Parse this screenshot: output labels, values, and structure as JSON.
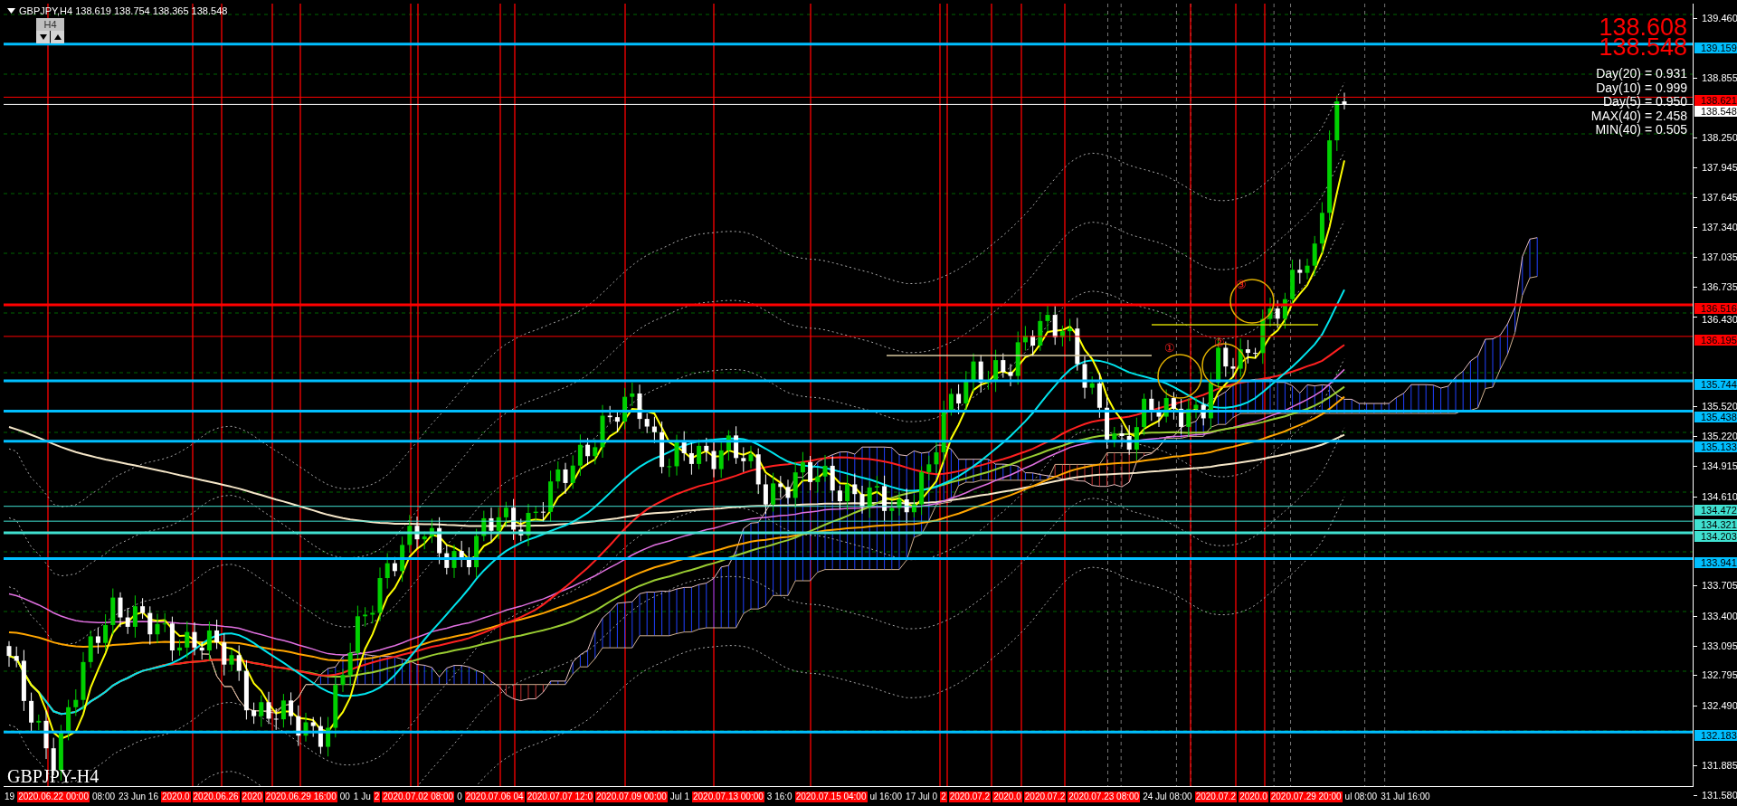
{
  "chart": {
    "title": "GBPJPY,H4 138.619 138.754 138.365 138.548",
    "period_button": {
      "label": "H4"
    },
    "price_big": [
      "138.608",
      "138.548"
    ],
    "stats": [
      "Day(20) = 0.931",
      "Day(10) = 0.999",
      "Day(5) = 0.950",
      "MAX(40) = 2.458",
      "MIN(40) = 0.505"
    ],
    "annotations": [
      "①",
      "②",
      "③"
    ],
    "chart_label": "GBPJPY-H4"
  },
  "price_axis": [
    {
      "text": "139.460",
      "kind": "tick"
    },
    {
      "text": "139.159",
      "kind": "marker",
      "color": "#00bfff",
      "thick": true
    },
    {
      "text": "138.855",
      "kind": "tick"
    },
    {
      "text": "138.621",
      "kind": "marker",
      "color": "#ff0000",
      "thick": false
    },
    {
      "text": "138.548",
      "kind": "marker",
      "color": "#ffffff",
      "thick": false
    },
    {
      "text": "138.250",
      "kind": "tick"
    },
    {
      "text": "137.945",
      "kind": "tick"
    },
    {
      "text": "137.645",
      "kind": "tick"
    },
    {
      "text": "137.340",
      "kind": "tick"
    },
    {
      "text": "137.035",
      "kind": "tick"
    },
    {
      "text": "136.735",
      "kind": "tick"
    },
    {
      "text": "136.516",
      "kind": "marker",
      "color": "#ff0000",
      "thick": true
    },
    {
      "text": "136.430",
      "kind": "tick"
    },
    {
      "text": "136.195",
      "kind": "marker",
      "color": "#ff0000",
      "thick": false
    },
    {
      "text": "135.744",
      "kind": "marker",
      "color": "#00bfff",
      "thick": true
    },
    {
      "text": "135.520",
      "kind": "tick"
    },
    {
      "text": "135.438",
      "kind": "marker",
      "color": "#00bfff",
      "thick": true
    },
    {
      "text": "135.220",
      "kind": "tick"
    },
    {
      "text": "135.133",
      "kind": "marker",
      "color": "#00bfff",
      "thick": true
    },
    {
      "text": "134.915",
      "kind": "tick"
    },
    {
      "text": "134.610",
      "kind": "tick"
    },
    {
      "text": "134.472",
      "kind": "marker",
      "color": "#40e0d0",
      "thick": false
    },
    {
      "text": "134.321",
      "kind": "marker",
      "color": "#40e0d0",
      "thick": false
    },
    {
      "text": "134.203",
      "kind": "marker",
      "color": "#40e0d0",
      "thick": true
    },
    {
      "text": "133.941",
      "kind": "marker",
      "color": "#00bfff",
      "thick": true
    },
    {
      "text": "133.705",
      "kind": "tick"
    },
    {
      "text": "133.400",
      "kind": "tick"
    },
    {
      "text": "133.095",
      "kind": "tick"
    },
    {
      "text": "132.795",
      "kind": "tick"
    },
    {
      "text": "132.490",
      "kind": "tick"
    },
    {
      "text": "132.183",
      "kind": "marker",
      "color": "#00bfff",
      "thick": true
    },
    {
      "text": "131.885",
      "kind": "tick"
    },
    {
      "text": "131.580",
      "kind": "tick"
    }
  ],
  "time_axis": [
    {
      "text": "19",
      "kind": "tick"
    },
    {
      "text": "2020.06.22 00:00",
      "kind": "marker"
    },
    {
      "text": "08:00",
      "kind": "tick"
    },
    {
      "text": "23 Jun 16",
      "kind": "tick"
    },
    {
      "text": "2020.0",
      "kind": "marker"
    },
    {
      "text": "2020.06.26",
      "kind": "marker"
    },
    {
      "text": "2020",
      "kind": "marker"
    },
    {
      "text": "2020.06.29 16:00",
      "kind": "marker"
    },
    {
      "text": "00",
      "kind": "tick"
    },
    {
      "text": "1 Ju",
      "kind": "tick"
    },
    {
      "text": "2",
      "kind": "marker"
    },
    {
      "text": "2020.07.02 08:00",
      "kind": "marker"
    },
    {
      "text": "0",
      "kind": "tick"
    },
    {
      "text": "2020.07.06 04",
      "kind": "marker"
    },
    {
      "text": "2020.07.07 12:0",
      "kind": "marker"
    },
    {
      "text": "2020.07.09 00:00",
      "kind": "marker"
    },
    {
      "text": "Jul 1",
      "kind": "tick"
    },
    {
      "text": "2020.07.13 00:00",
      "kind": "marker"
    },
    {
      "text": "3 16:0",
      "kind": "tick"
    },
    {
      "text": "2020.07.15 04:00",
      "kind": "marker"
    },
    {
      "text": "ul 16:00",
      "kind": "tick"
    },
    {
      "text": "17 Jul 0",
      "kind": "tick"
    },
    {
      "text": "2",
      "kind": "marker"
    },
    {
      "text": "2020.07.2",
      "kind": "marker"
    },
    {
      "text": "2020.0",
      "kind": "marker"
    },
    {
      "text": "2020.07.2",
      "kind": "marker"
    },
    {
      "text": "2020.07.23 08:00",
      "kind": "marker"
    },
    {
      "text": "24 Jul 08:00",
      "kind": "tick"
    },
    {
      "text": "2020.07.2",
      "kind": "marker"
    },
    {
      "text": "2020.0",
      "kind": "marker"
    },
    {
      "text": "2020.07.29 20:00",
      "kind": "marker"
    },
    {
      "text": "ul 08:00",
      "kind": "tick"
    },
    {
      "text": "31 Jul 16:00",
      "kind": "tick"
    }
  ]
}
